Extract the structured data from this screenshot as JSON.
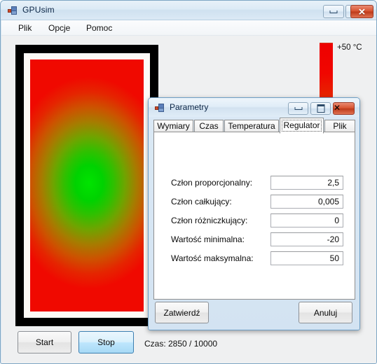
{
  "window": {
    "title": "GPUsim",
    "icon": "app-icon",
    "controls": [
      {
        "name": "minimize",
        "glyph": "minimize-icon"
      },
      {
        "name": "maximize",
        "glyph": "maximize-icon"
      },
      {
        "name": "close",
        "glyph": "close-icon",
        "label": "✕",
        "color": "#d6512f"
      }
    ],
    "menu": [
      {
        "label": "Plik"
      },
      {
        "label": "Opcje"
      },
      {
        "label": "Pomoc"
      }
    ]
  },
  "simulation": {
    "heatmap": {
      "description": "thermal-field-visualization",
      "hot_color": "#f00500",
      "cool_color": "#00e400",
      "frame_color": "#000000",
      "inner_frame_color": "#fdfaf6"
    },
    "legend": {
      "top_label": "+50 °C",
      "gradient_top": "#ee0000",
      "gradient_bottom": "#d14a06"
    },
    "controls": {
      "start_label": "Start",
      "stop_label": "Stop",
      "status": "Czas: 2850 / 10000"
    }
  },
  "dialog": {
    "title": "Parametry",
    "icon": "dialog-icon",
    "controls": [
      {
        "name": "minimize",
        "glyph": "minimize-icon"
      },
      {
        "name": "maximize",
        "glyph": "maximize-icon"
      },
      {
        "name": "close",
        "glyph": "close-icon",
        "label": "✕"
      }
    ],
    "tabs": [
      {
        "label": "Wymiary",
        "active": false
      },
      {
        "label": "Czas",
        "active": false
      },
      {
        "label": "Temperatura",
        "active": false
      },
      {
        "label": "Regulator",
        "active": true
      },
      {
        "label": "Plik",
        "active": false
      }
    ],
    "fields": [
      {
        "label": "Człon proporcjonalny:",
        "value": "2,5"
      },
      {
        "label": "Człon całkujący:",
        "value": "0,005"
      },
      {
        "label": "Człon różniczkujący:",
        "value": "0"
      },
      {
        "label": "Wartość minimalna:",
        "value": "-20"
      },
      {
        "label": "Wartość maksymalna:",
        "value": "50"
      }
    ],
    "buttons": {
      "confirm_label": "Zatwierdź",
      "cancel_label": "Anuluj"
    }
  }
}
